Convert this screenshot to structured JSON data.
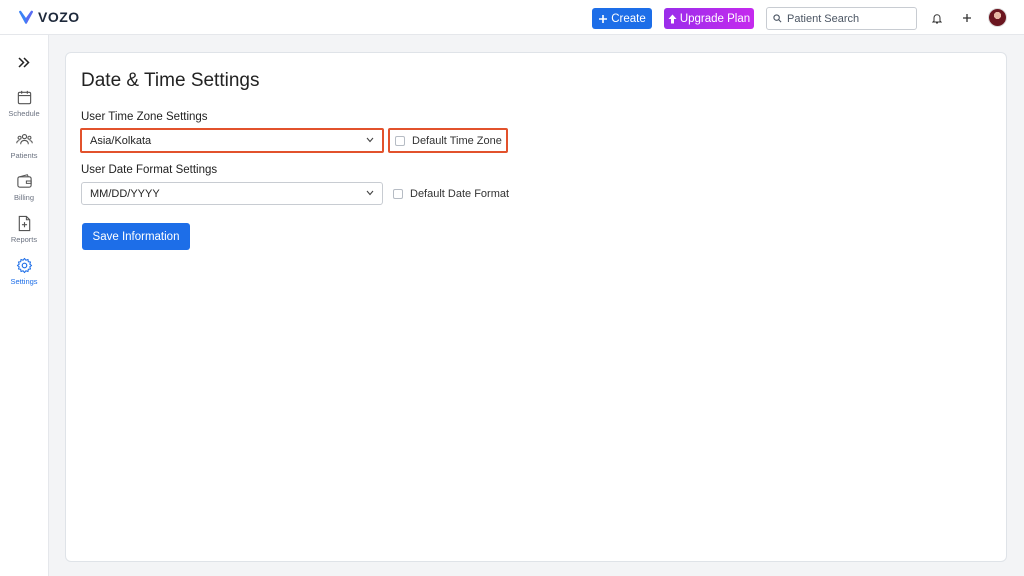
{
  "app": {
    "logo_text": "VOZO"
  },
  "header": {
    "create_label": "Create",
    "upgrade_label": "Upgrade Plan",
    "search_placeholder": "Patient Search"
  },
  "sidebar": {
    "items": [
      {
        "label": "Schedule",
        "icon": "calendar-icon"
      },
      {
        "label": "Patients",
        "icon": "users-icon"
      },
      {
        "label": "Billing",
        "icon": "wallet-icon"
      },
      {
        "label": "Reports",
        "icon": "report-icon"
      },
      {
        "label": "Settings",
        "icon": "gear-icon",
        "active": true
      }
    ]
  },
  "page": {
    "title": "Date & Time Settings",
    "timezone": {
      "section_label": "User Time Zone Settings",
      "value": "Asia/Kolkata",
      "default_checkbox_label": "Default Time Zone",
      "default_checked": false
    },
    "date_format": {
      "section_label": "User Date Format Settings",
      "value": "MM/DD/YYYY",
      "default_checkbox_label": "Default Date Format",
      "default_checked": false
    },
    "save_label": "Save Information"
  },
  "colors": {
    "primary": "#1d6ee8",
    "upgrade_gradient_start": "#9a2dea",
    "upgrade_gradient_end": "#c52aee",
    "highlight_border": "#e2522c"
  }
}
